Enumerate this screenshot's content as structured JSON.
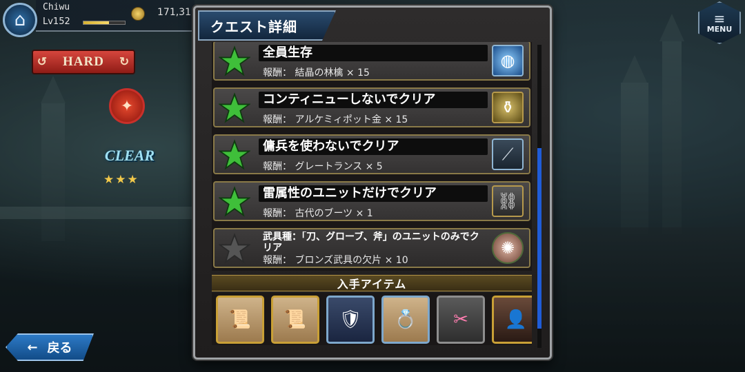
{
  "hud": {
    "player_name": "Chiwu",
    "level": "Lv152",
    "exp_progress": 0.62,
    "coins": "171,31",
    "difficulty_label": "HARD",
    "clear_label": "CLEAR",
    "node_stars": "★★★",
    "menu_label": "MENU",
    "back_label": "戻る"
  },
  "panel": {
    "title": "クエスト詳細",
    "reward_prefix": "報酬：",
    "missions": [
      {
        "title": "全員生存",
        "reward": "結晶の林檎 × 15",
        "done": true,
        "icon": "apple-crystal-icon"
      },
      {
        "title": "コンティニューしないでクリア",
        "reward": "アルケミィポット金 × 15",
        "done": true,
        "icon": "alchemy-pot-icon"
      },
      {
        "title": "傭兵を使わないでクリア",
        "reward": "グレートランス × 5",
        "done": true,
        "icon": "great-lance-icon"
      },
      {
        "title": "雷属性のユニットだけでクリア",
        "reward": "古代のブーツ × 1",
        "done": true,
        "icon": "ancient-boots-icon"
      },
      {
        "title": "武具種：「刀、グローブ、斧」のユニットのみでクリア",
        "reward": "ブロンズ武具の欠片 × 10",
        "done": false,
        "icon": "bronze-shard-icon"
      }
    ],
    "items_title": "入手アイテム",
    "items": [
      {
        "icon": "scroll-unit-icon"
      },
      {
        "icon": "scroll-purple-icon"
      },
      {
        "icon": "shield-crest-icon"
      },
      {
        "icon": "ring-scroll-icon"
      },
      {
        "icon": "ticket-icon"
      },
      {
        "icon": "hero-portrait-icon"
      }
    ]
  },
  "colors": {
    "star_done": "#3fbf3a",
    "star_locked": "#555555",
    "scroll_thumb": "#1f5cd8",
    "gold_border": "#b79a4c"
  }
}
